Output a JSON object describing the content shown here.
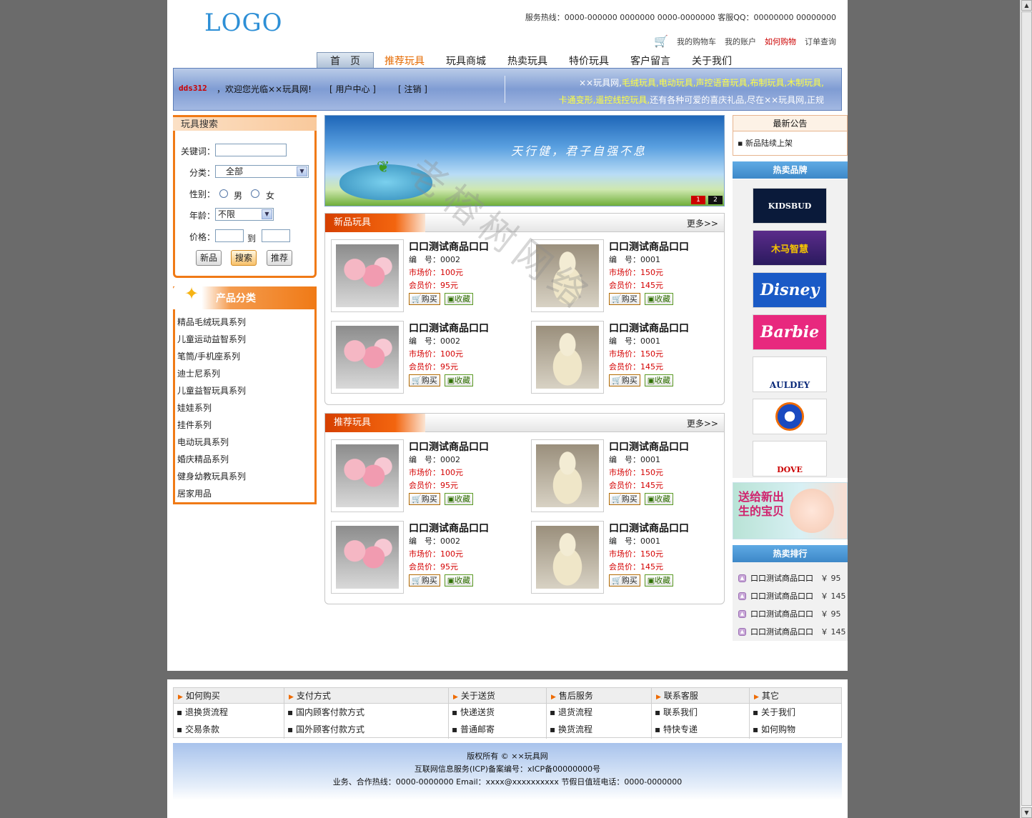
{
  "header": {
    "logo": "LOGO",
    "hotline": "服务热线：0000-000000  0000000   0000-0000000   客服QQ：00000000   00000000",
    "links": [
      "我的购物车",
      "我的账户",
      "如何购物",
      "订单查询"
    ]
  },
  "nav": {
    "tabs": [
      "首　页",
      "推荐玩具",
      "玩具商城",
      "热卖玩具",
      "特价玩具",
      "客户留言",
      "关于我们"
    ]
  },
  "welcome": {
    "username": "dds312",
    "message": "，欢迎您光临××玩具网!",
    "user_center": "[ 用户中心 ]",
    "logout": "[ 注销 ]",
    "intro_line1_a": "××玩具网,",
    "intro_line1_b": "毛绒玩具,电动玩具,声控语音玩具,布制玩具,木制玩具,",
    "intro_line2_a": "卡通变形,遥控线控玩具,",
    "intro_line2_b": "还有各种可爱的喜庆礼品,尽在××玩具网,正规"
  },
  "search": {
    "title": "玩具搜索",
    "keyword_label": "关键词：",
    "keyword_value": "",
    "category_label": "分类：",
    "category_value": "全部",
    "gender_label": "性别：",
    "gender_options": [
      "男",
      "女"
    ],
    "age_label": "年龄：",
    "age_value": "不限",
    "price_label": "价格：",
    "price_to": "到",
    "buttons": [
      "新品",
      "搜索",
      "推荐"
    ]
  },
  "categories": {
    "title": "产品分类",
    "items": [
      "精品毛绒玩具系列",
      "儿童运动益智系列",
      "笔筒/手机座系列",
      "迪士尼系列",
      "儿童益智玩具系列",
      "娃娃系列",
      "挂件系列",
      "电动玩具系列",
      "婚庆精品系列",
      "健身幼教玩具系列",
      "居家用品"
    ]
  },
  "banner": {
    "slogan": "天行健，君子自强不息",
    "pages": [
      "1",
      "2"
    ]
  },
  "sections": [
    {
      "title": "新品玩具",
      "more": "更多>>",
      "products": [
        {
          "name": "口口测试商品口口",
          "code": "编　号：0002",
          "market": "市场价：100元",
          "member": "会员价：95元",
          "buy": "购买",
          "fav": "收藏"
        },
        {
          "name": "口口测试商品口口",
          "code": "编　号：0001",
          "market": "市场价：150元",
          "member": "会员价：145元",
          "buy": "购买",
          "fav": "收藏"
        },
        {
          "name": "口口测试商品口口",
          "code": "编　号：0002",
          "market": "市场价：100元",
          "member": "会员价：95元",
          "buy": "购买",
          "fav": "收藏"
        },
        {
          "name": "口口测试商品口口",
          "code": "编　号：0001",
          "market": "市场价：150元",
          "member": "会员价：145元",
          "buy": "购买",
          "fav": "收藏"
        }
      ]
    },
    {
      "title": "推荐玩具",
      "more": "更多>>",
      "products": [
        {
          "name": "口口测试商品口口",
          "code": "编　号：0002",
          "market": "市场价：100元",
          "member": "会员价：95元",
          "buy": "购买",
          "fav": "收藏"
        },
        {
          "name": "口口测试商品口口",
          "code": "编　号：0001",
          "market": "市场价：150元",
          "member": "会员价：145元",
          "buy": "购买",
          "fav": "收藏"
        },
        {
          "name": "口口测试商品口口",
          "code": "编　号：0002",
          "market": "市场价：100元",
          "member": "会员价：95元",
          "buy": "购买",
          "fav": "收藏"
        },
        {
          "name": "口口测试商品口口",
          "code": "编　号：0001",
          "market": "市场价：150元",
          "member": "会员价：145元",
          "buy": "购买",
          "fav": "收藏"
        }
      ]
    }
  ],
  "notice": {
    "title": "最新公告",
    "items": [
      "新品陆续上架"
    ]
  },
  "brands": {
    "title": "热卖品牌",
    "items": [
      "KIDSBUD",
      "木马智慧",
      "Disney",
      "Barbie",
      "AULDEY",
      "",
      "DOVE"
    ]
  },
  "promo": {
    "text": "送给新出生的宝贝"
  },
  "ranking": {
    "title": "热卖排行",
    "items": [
      {
        "name": "口口测试商品口口",
        "price": "￥ 95"
      },
      {
        "name": "口口测试商品口口",
        "price": "￥ 145"
      },
      {
        "name": "口口测试商品口口",
        "price": "￥ 95"
      },
      {
        "name": "口口测试商品口口",
        "price": "￥ 145"
      }
    ]
  },
  "footer": {
    "columns": [
      {
        "title": "如何购买",
        "items": [
          "退换货流程",
          "交易条款"
        ]
      },
      {
        "title": "支付方式",
        "items": [
          "国内顾客付款方式",
          "国外顾客付款方式"
        ]
      },
      {
        "title": "关于送货",
        "items": [
          "快递送货",
          "普通邮寄"
        ]
      },
      {
        "title": "售后服务",
        "items": [
          "退货流程",
          "换货流程"
        ]
      },
      {
        "title": "联系客服",
        "items": [
          "联系我们",
          "特快专递"
        ]
      },
      {
        "title": "其它",
        "items": [
          "关于我们",
          "如何购物"
        ]
      }
    ],
    "copyright": "版权所有 © ××玩具网",
    "icp": "互联网信息服务(ICP)备案编号：xICP备00000000号",
    "contact": "业务、合作热线：0000-0000000   Email：xxxx@xxxxxxxxxx   节假日值班电话：0000-0000000"
  },
  "watermark": "老榕树网络",
  "colors": {
    "accent_orange": "#f07a16",
    "nav_blue": "#7f9cd3",
    "price_red": "#d40000",
    "background_gray": "#6b6b6b"
  }
}
